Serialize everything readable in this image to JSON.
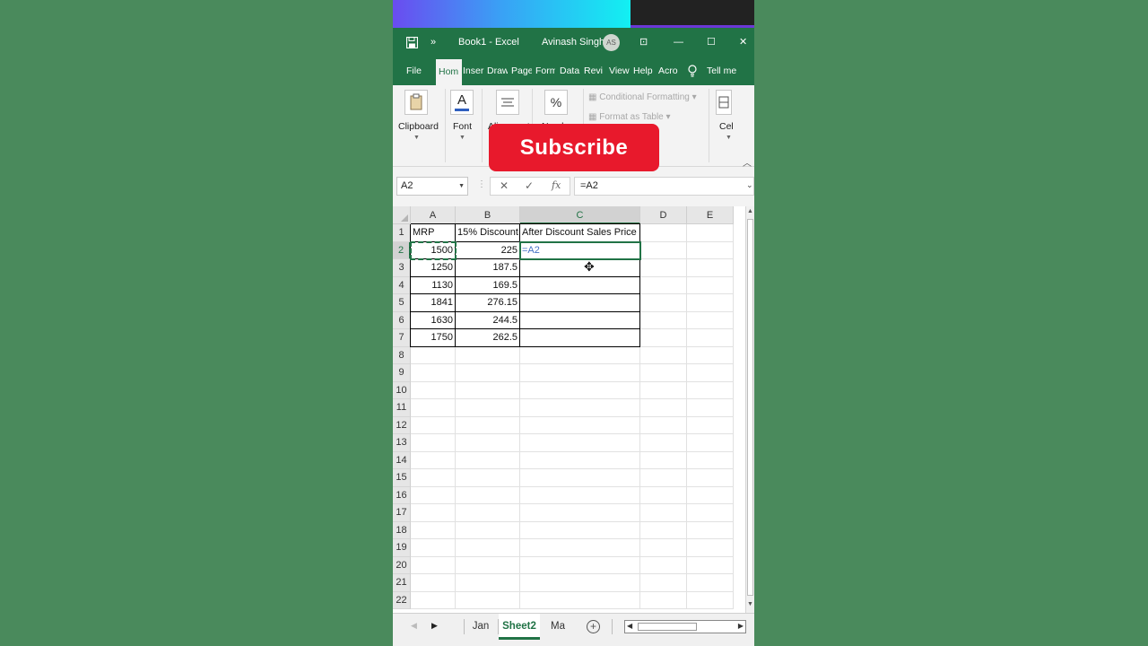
{
  "title_bar": {
    "doc_title": "Book1  -  Excel",
    "user_name": "Avinash Singh",
    "avatar_initials": "AS"
  },
  "tabs": [
    "File",
    "Hom",
    "Inser",
    "Draw",
    "Page",
    "Form",
    "Data",
    "Revi",
    "View",
    "Help",
    "Acro",
    "Tell me"
  ],
  "active_tab": "Hom",
  "ribbon": {
    "clipboard": "Clipboard",
    "font": "Font",
    "font_button": "A",
    "alignment": "Alignment",
    "number": "Number",
    "number_button": "%",
    "conditional_formatting": "Conditional Formatting",
    "format_as_table": "Format as Table",
    "cells": "Cel"
  },
  "overlay": {
    "subscribe": "Subscribe"
  },
  "formula_bar": {
    "name_box": "A2",
    "cancel": "✕",
    "enter": "✓",
    "fx": "fx",
    "formula": "=A2"
  },
  "grid": {
    "columns": [
      "A",
      "B",
      "C",
      "D",
      "E"
    ],
    "rows": [
      "1",
      "2",
      "3",
      "4",
      "5",
      "6",
      "7",
      "8",
      "9",
      "10",
      "11",
      "12",
      "13",
      "14",
      "15",
      "16",
      "17",
      "18",
      "19",
      "20",
      "21",
      "22"
    ],
    "headers": [
      "MRP",
      "15% Discount",
      "After Discount Sales Price"
    ],
    "data": [
      [
        "1500",
        "225"
      ],
      [
        "1250",
        "187.5"
      ],
      [
        "1130",
        "169.5"
      ],
      [
        "1841",
        "276.15"
      ],
      [
        "1630",
        "244.5"
      ],
      [
        "1750",
        "262.5"
      ]
    ],
    "editing_cell_text": "=A2"
  },
  "sheets": [
    "Jan",
    "Sheet2",
    "Ma"
  ],
  "active_sheet": "Sheet2",
  "colors": {
    "excel_green": "#217346",
    "subscribe_red": "#e8192c",
    "background": "#4a8a5c",
    "formula_ref_blue": "#4472c4"
  }
}
